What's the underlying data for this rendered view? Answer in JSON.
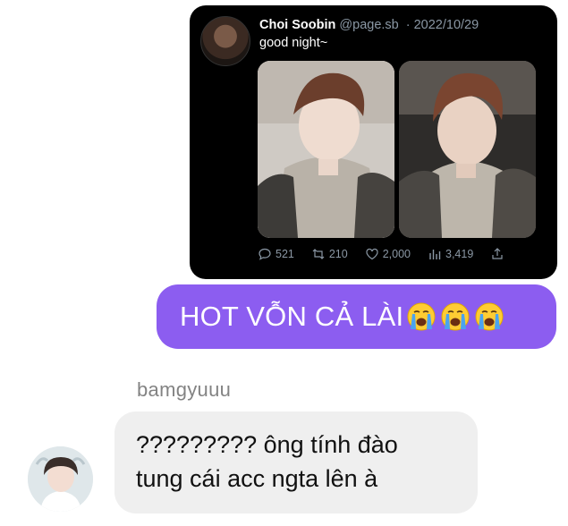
{
  "tweet": {
    "display_name": "Choi Soobin",
    "handle": "@page.sb",
    "separator": "·",
    "date": "2022/10/29",
    "text": "good night~",
    "photos": [
      "photo-1",
      "photo-2"
    ],
    "stats": {
      "replies": "521",
      "retweets": "210",
      "likes": "2,000",
      "views": "3,419"
    }
  },
  "messages": {
    "outgoing": {
      "text": "HOT VỖN CẢ LÀI",
      "emoji": [
        "loudly-crying-face",
        "loudly-crying-face",
        "loudly-crying-face"
      ]
    },
    "incoming": {
      "sender": "bamgyuuu",
      "line1": "????????? ông tính đào",
      "line2": "tung cái acc ngta lên à"
    }
  },
  "colors": {
    "outgoing_bubble": "#8c5df0",
    "incoming_bubble": "#efefef",
    "tweet_bg": "#000000",
    "tweet_meta": "#8b98a5"
  }
}
